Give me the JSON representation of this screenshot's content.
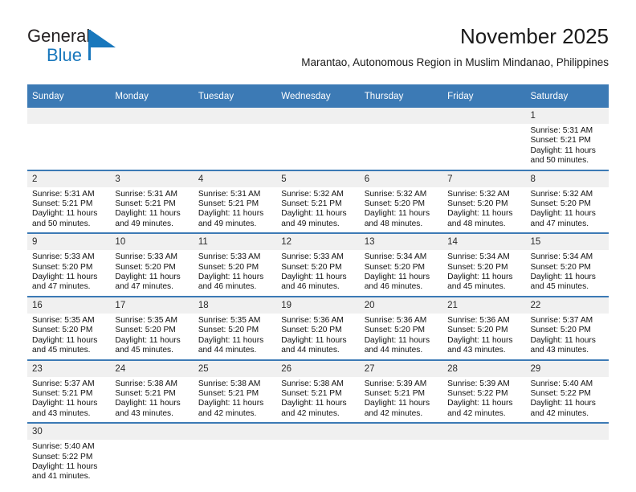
{
  "brand": {
    "logo_text_primary": "General",
    "logo_text_secondary": "Blue",
    "accent_color": "#1877bc",
    "header_color": "#3c7ab5"
  },
  "header": {
    "title": "November 2025",
    "subtitle": "Marantao, Autonomous Region in Muslim Mindanao, Philippines"
  },
  "calendar": {
    "weekday_headers": [
      "Sunday",
      "Monday",
      "Tuesday",
      "Wednesday",
      "Thursday",
      "Friday",
      "Saturday"
    ],
    "weeks": [
      [
        {
          "day": "",
          "empty": true,
          "sunrise": "",
          "sunset": "",
          "daylight_line1": "",
          "daylight_line2": ""
        },
        {
          "day": "",
          "empty": true,
          "sunrise": "",
          "sunset": "",
          "daylight_line1": "",
          "daylight_line2": ""
        },
        {
          "day": "",
          "empty": true,
          "sunrise": "",
          "sunset": "",
          "daylight_line1": "",
          "daylight_line2": ""
        },
        {
          "day": "",
          "empty": true,
          "sunrise": "",
          "sunset": "",
          "daylight_line1": "",
          "daylight_line2": ""
        },
        {
          "day": "",
          "empty": true,
          "sunrise": "",
          "sunset": "",
          "daylight_line1": "",
          "daylight_line2": ""
        },
        {
          "day": "",
          "empty": true,
          "sunrise": "",
          "sunset": "",
          "daylight_line1": "",
          "daylight_line2": ""
        },
        {
          "day": "1",
          "empty": false,
          "sunrise": "Sunrise: 5:31 AM",
          "sunset": "Sunset: 5:21 PM",
          "daylight_line1": "Daylight: 11 hours",
          "daylight_line2": "and 50 minutes."
        }
      ],
      [
        {
          "day": "2",
          "empty": false,
          "sunrise": "Sunrise: 5:31 AM",
          "sunset": "Sunset: 5:21 PM",
          "daylight_line1": "Daylight: 11 hours",
          "daylight_line2": "and 50 minutes."
        },
        {
          "day": "3",
          "empty": false,
          "sunrise": "Sunrise: 5:31 AM",
          "sunset": "Sunset: 5:21 PM",
          "daylight_line1": "Daylight: 11 hours",
          "daylight_line2": "and 49 minutes."
        },
        {
          "day": "4",
          "empty": false,
          "sunrise": "Sunrise: 5:31 AM",
          "sunset": "Sunset: 5:21 PM",
          "daylight_line1": "Daylight: 11 hours",
          "daylight_line2": "and 49 minutes."
        },
        {
          "day": "5",
          "empty": false,
          "sunrise": "Sunrise: 5:32 AM",
          "sunset": "Sunset: 5:21 PM",
          "daylight_line1": "Daylight: 11 hours",
          "daylight_line2": "and 49 minutes."
        },
        {
          "day": "6",
          "empty": false,
          "sunrise": "Sunrise: 5:32 AM",
          "sunset": "Sunset: 5:20 PM",
          "daylight_line1": "Daylight: 11 hours",
          "daylight_line2": "and 48 minutes."
        },
        {
          "day": "7",
          "empty": false,
          "sunrise": "Sunrise: 5:32 AM",
          "sunset": "Sunset: 5:20 PM",
          "daylight_line1": "Daylight: 11 hours",
          "daylight_line2": "and 48 minutes."
        },
        {
          "day": "8",
          "empty": false,
          "sunrise": "Sunrise: 5:32 AM",
          "sunset": "Sunset: 5:20 PM",
          "daylight_line1": "Daylight: 11 hours",
          "daylight_line2": "and 47 minutes."
        }
      ],
      [
        {
          "day": "9",
          "empty": false,
          "sunrise": "Sunrise: 5:33 AM",
          "sunset": "Sunset: 5:20 PM",
          "daylight_line1": "Daylight: 11 hours",
          "daylight_line2": "and 47 minutes."
        },
        {
          "day": "10",
          "empty": false,
          "sunrise": "Sunrise: 5:33 AM",
          "sunset": "Sunset: 5:20 PM",
          "daylight_line1": "Daylight: 11 hours",
          "daylight_line2": "and 47 minutes."
        },
        {
          "day": "11",
          "empty": false,
          "sunrise": "Sunrise: 5:33 AM",
          "sunset": "Sunset: 5:20 PM",
          "daylight_line1": "Daylight: 11 hours",
          "daylight_line2": "and 46 minutes."
        },
        {
          "day": "12",
          "empty": false,
          "sunrise": "Sunrise: 5:33 AM",
          "sunset": "Sunset: 5:20 PM",
          "daylight_line1": "Daylight: 11 hours",
          "daylight_line2": "and 46 minutes."
        },
        {
          "day": "13",
          "empty": false,
          "sunrise": "Sunrise: 5:34 AM",
          "sunset": "Sunset: 5:20 PM",
          "daylight_line1": "Daylight: 11 hours",
          "daylight_line2": "and 46 minutes."
        },
        {
          "day": "14",
          "empty": false,
          "sunrise": "Sunrise: 5:34 AM",
          "sunset": "Sunset: 5:20 PM",
          "daylight_line1": "Daylight: 11 hours",
          "daylight_line2": "and 45 minutes."
        },
        {
          "day": "15",
          "empty": false,
          "sunrise": "Sunrise: 5:34 AM",
          "sunset": "Sunset: 5:20 PM",
          "daylight_line1": "Daylight: 11 hours",
          "daylight_line2": "and 45 minutes."
        }
      ],
      [
        {
          "day": "16",
          "empty": false,
          "sunrise": "Sunrise: 5:35 AM",
          "sunset": "Sunset: 5:20 PM",
          "daylight_line1": "Daylight: 11 hours",
          "daylight_line2": "and 45 minutes."
        },
        {
          "day": "17",
          "empty": false,
          "sunrise": "Sunrise: 5:35 AM",
          "sunset": "Sunset: 5:20 PM",
          "daylight_line1": "Daylight: 11 hours",
          "daylight_line2": "and 45 minutes."
        },
        {
          "day": "18",
          "empty": false,
          "sunrise": "Sunrise: 5:35 AM",
          "sunset": "Sunset: 5:20 PM",
          "daylight_line1": "Daylight: 11 hours",
          "daylight_line2": "and 44 minutes."
        },
        {
          "day": "19",
          "empty": false,
          "sunrise": "Sunrise: 5:36 AM",
          "sunset": "Sunset: 5:20 PM",
          "daylight_line1": "Daylight: 11 hours",
          "daylight_line2": "and 44 minutes."
        },
        {
          "day": "20",
          "empty": false,
          "sunrise": "Sunrise: 5:36 AM",
          "sunset": "Sunset: 5:20 PM",
          "daylight_line1": "Daylight: 11 hours",
          "daylight_line2": "and 44 minutes."
        },
        {
          "day": "21",
          "empty": false,
          "sunrise": "Sunrise: 5:36 AM",
          "sunset": "Sunset: 5:20 PM",
          "daylight_line1": "Daylight: 11 hours",
          "daylight_line2": "and 43 minutes."
        },
        {
          "day": "22",
          "empty": false,
          "sunrise": "Sunrise: 5:37 AM",
          "sunset": "Sunset: 5:20 PM",
          "daylight_line1": "Daylight: 11 hours",
          "daylight_line2": "and 43 minutes."
        }
      ],
      [
        {
          "day": "23",
          "empty": false,
          "sunrise": "Sunrise: 5:37 AM",
          "sunset": "Sunset: 5:21 PM",
          "daylight_line1": "Daylight: 11 hours",
          "daylight_line2": "and 43 minutes."
        },
        {
          "day": "24",
          "empty": false,
          "sunrise": "Sunrise: 5:38 AM",
          "sunset": "Sunset: 5:21 PM",
          "daylight_line1": "Daylight: 11 hours",
          "daylight_line2": "and 43 minutes."
        },
        {
          "day": "25",
          "empty": false,
          "sunrise": "Sunrise: 5:38 AM",
          "sunset": "Sunset: 5:21 PM",
          "daylight_line1": "Daylight: 11 hours",
          "daylight_line2": "and 42 minutes."
        },
        {
          "day": "26",
          "empty": false,
          "sunrise": "Sunrise: 5:38 AM",
          "sunset": "Sunset: 5:21 PM",
          "daylight_line1": "Daylight: 11 hours",
          "daylight_line2": "and 42 minutes."
        },
        {
          "day": "27",
          "empty": false,
          "sunrise": "Sunrise: 5:39 AM",
          "sunset": "Sunset: 5:21 PM",
          "daylight_line1": "Daylight: 11 hours",
          "daylight_line2": "and 42 minutes."
        },
        {
          "day": "28",
          "empty": false,
          "sunrise": "Sunrise: 5:39 AM",
          "sunset": "Sunset: 5:22 PM",
          "daylight_line1": "Daylight: 11 hours",
          "daylight_line2": "and 42 minutes."
        },
        {
          "day": "29",
          "empty": false,
          "sunrise": "Sunrise: 5:40 AM",
          "sunset": "Sunset: 5:22 PM",
          "daylight_line1": "Daylight: 11 hours",
          "daylight_line2": "and 42 minutes."
        }
      ],
      [
        {
          "day": "30",
          "empty": false,
          "sunrise": "Sunrise: 5:40 AM",
          "sunset": "Sunset: 5:22 PM",
          "daylight_line1": "Daylight: 11 hours",
          "daylight_line2": "and 41 minutes."
        },
        {
          "day": "",
          "empty": true,
          "sunrise": "",
          "sunset": "",
          "daylight_line1": "",
          "daylight_line2": ""
        },
        {
          "day": "",
          "empty": true,
          "sunrise": "",
          "sunset": "",
          "daylight_line1": "",
          "daylight_line2": ""
        },
        {
          "day": "",
          "empty": true,
          "sunrise": "",
          "sunset": "",
          "daylight_line1": "",
          "daylight_line2": ""
        },
        {
          "day": "",
          "empty": true,
          "sunrise": "",
          "sunset": "",
          "daylight_line1": "",
          "daylight_line2": ""
        },
        {
          "day": "",
          "empty": true,
          "sunrise": "",
          "sunset": "",
          "daylight_line1": "",
          "daylight_line2": ""
        },
        {
          "day": "",
          "empty": true,
          "sunrise": "",
          "sunset": "",
          "daylight_line1": "",
          "daylight_line2": ""
        }
      ]
    ]
  }
}
